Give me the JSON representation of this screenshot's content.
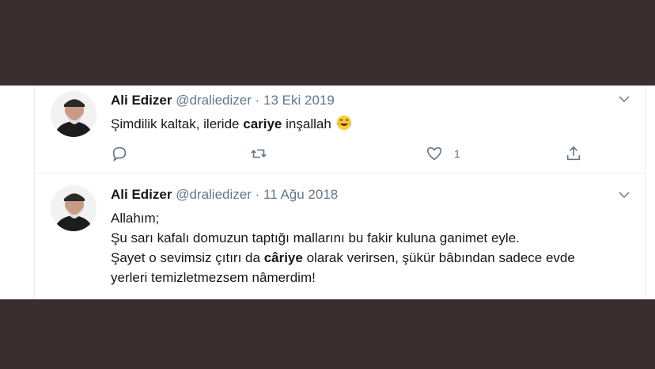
{
  "tweets": [
    {
      "name": "Ali Edizer",
      "handle": "@draliedizer",
      "separator": "·",
      "date": "13 Eki 2019",
      "text_pre": "Şimdilik kaltak, ileride ",
      "text_bold": "cariye",
      "text_post": " inşallah",
      "like_count": "1"
    },
    {
      "name": "Ali Edizer",
      "handle": "@draliedizer",
      "separator": "·",
      "date": "11 Ağu 2018",
      "line1": "Allahım;",
      "line2": "Şu sarı kafalı domuzun taptığı mallarını bu fakir kuluna ganimet eyle.",
      "line3_pre": "Şayet o sevimsiz çıtırı da ",
      "line3_bold": "câriye",
      "line3_post": " olarak verirsen, şükür bâbından sadece evde",
      "line4": "yerleri temizletmezsem nâmerdim!"
    }
  ],
  "icons": {
    "reply": "reply-icon",
    "retweet": "retweet-icon",
    "like": "heart-icon",
    "share": "share-icon",
    "more": "chevron-down-icon",
    "emoji": "tears-of-joy-emoji"
  },
  "colors": {
    "background": "#3a2f2f",
    "muted": "#657786",
    "text": "#14171a"
  }
}
